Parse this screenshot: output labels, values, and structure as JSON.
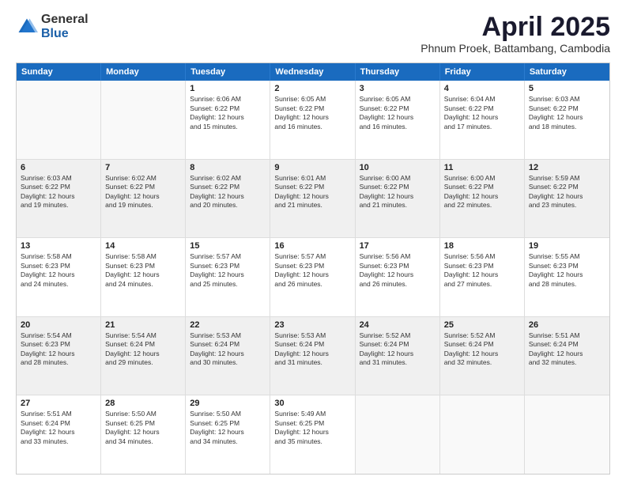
{
  "header": {
    "logo_general": "General",
    "logo_blue": "Blue",
    "month_title": "April 2025",
    "location": "Phnum Proek, Battambang, Cambodia"
  },
  "calendar": {
    "days_of_week": [
      "Sunday",
      "Monday",
      "Tuesday",
      "Wednesday",
      "Thursday",
      "Friday",
      "Saturday"
    ],
    "weeks": [
      [
        {
          "day": "",
          "info": "",
          "empty": true
        },
        {
          "day": "",
          "info": "",
          "empty": true
        },
        {
          "day": "1",
          "info": "Sunrise: 6:06 AM\nSunset: 6:22 PM\nDaylight: 12 hours\nand 15 minutes."
        },
        {
          "day": "2",
          "info": "Sunrise: 6:05 AM\nSunset: 6:22 PM\nDaylight: 12 hours\nand 16 minutes."
        },
        {
          "day": "3",
          "info": "Sunrise: 6:05 AM\nSunset: 6:22 PM\nDaylight: 12 hours\nand 16 minutes."
        },
        {
          "day": "4",
          "info": "Sunrise: 6:04 AM\nSunset: 6:22 PM\nDaylight: 12 hours\nand 17 minutes."
        },
        {
          "day": "5",
          "info": "Sunrise: 6:03 AM\nSunset: 6:22 PM\nDaylight: 12 hours\nand 18 minutes."
        }
      ],
      [
        {
          "day": "6",
          "info": "Sunrise: 6:03 AM\nSunset: 6:22 PM\nDaylight: 12 hours\nand 19 minutes."
        },
        {
          "day": "7",
          "info": "Sunrise: 6:02 AM\nSunset: 6:22 PM\nDaylight: 12 hours\nand 19 minutes."
        },
        {
          "day": "8",
          "info": "Sunrise: 6:02 AM\nSunset: 6:22 PM\nDaylight: 12 hours\nand 20 minutes."
        },
        {
          "day": "9",
          "info": "Sunrise: 6:01 AM\nSunset: 6:22 PM\nDaylight: 12 hours\nand 21 minutes."
        },
        {
          "day": "10",
          "info": "Sunrise: 6:00 AM\nSunset: 6:22 PM\nDaylight: 12 hours\nand 21 minutes."
        },
        {
          "day": "11",
          "info": "Sunrise: 6:00 AM\nSunset: 6:22 PM\nDaylight: 12 hours\nand 22 minutes."
        },
        {
          "day": "12",
          "info": "Sunrise: 5:59 AM\nSunset: 6:22 PM\nDaylight: 12 hours\nand 23 minutes."
        }
      ],
      [
        {
          "day": "13",
          "info": "Sunrise: 5:58 AM\nSunset: 6:23 PM\nDaylight: 12 hours\nand 24 minutes."
        },
        {
          "day": "14",
          "info": "Sunrise: 5:58 AM\nSunset: 6:23 PM\nDaylight: 12 hours\nand 24 minutes."
        },
        {
          "day": "15",
          "info": "Sunrise: 5:57 AM\nSunset: 6:23 PM\nDaylight: 12 hours\nand 25 minutes."
        },
        {
          "day": "16",
          "info": "Sunrise: 5:57 AM\nSunset: 6:23 PM\nDaylight: 12 hours\nand 26 minutes."
        },
        {
          "day": "17",
          "info": "Sunrise: 5:56 AM\nSunset: 6:23 PM\nDaylight: 12 hours\nand 26 minutes."
        },
        {
          "day": "18",
          "info": "Sunrise: 5:56 AM\nSunset: 6:23 PM\nDaylight: 12 hours\nand 27 minutes."
        },
        {
          "day": "19",
          "info": "Sunrise: 5:55 AM\nSunset: 6:23 PM\nDaylight: 12 hours\nand 28 minutes."
        }
      ],
      [
        {
          "day": "20",
          "info": "Sunrise: 5:54 AM\nSunset: 6:23 PM\nDaylight: 12 hours\nand 28 minutes."
        },
        {
          "day": "21",
          "info": "Sunrise: 5:54 AM\nSunset: 6:24 PM\nDaylight: 12 hours\nand 29 minutes."
        },
        {
          "day": "22",
          "info": "Sunrise: 5:53 AM\nSunset: 6:24 PM\nDaylight: 12 hours\nand 30 minutes."
        },
        {
          "day": "23",
          "info": "Sunrise: 5:53 AM\nSunset: 6:24 PM\nDaylight: 12 hours\nand 31 minutes."
        },
        {
          "day": "24",
          "info": "Sunrise: 5:52 AM\nSunset: 6:24 PM\nDaylight: 12 hours\nand 31 minutes."
        },
        {
          "day": "25",
          "info": "Sunrise: 5:52 AM\nSunset: 6:24 PM\nDaylight: 12 hours\nand 32 minutes."
        },
        {
          "day": "26",
          "info": "Sunrise: 5:51 AM\nSunset: 6:24 PM\nDaylight: 12 hours\nand 32 minutes."
        }
      ],
      [
        {
          "day": "27",
          "info": "Sunrise: 5:51 AM\nSunset: 6:24 PM\nDaylight: 12 hours\nand 33 minutes."
        },
        {
          "day": "28",
          "info": "Sunrise: 5:50 AM\nSunset: 6:25 PM\nDaylight: 12 hours\nand 34 minutes."
        },
        {
          "day": "29",
          "info": "Sunrise: 5:50 AM\nSunset: 6:25 PM\nDaylight: 12 hours\nand 34 minutes."
        },
        {
          "day": "30",
          "info": "Sunrise: 5:49 AM\nSunset: 6:25 PM\nDaylight: 12 hours\nand 35 minutes."
        },
        {
          "day": "",
          "info": "",
          "empty": true
        },
        {
          "day": "",
          "info": "",
          "empty": true
        },
        {
          "day": "",
          "info": "",
          "empty": true
        }
      ]
    ]
  }
}
